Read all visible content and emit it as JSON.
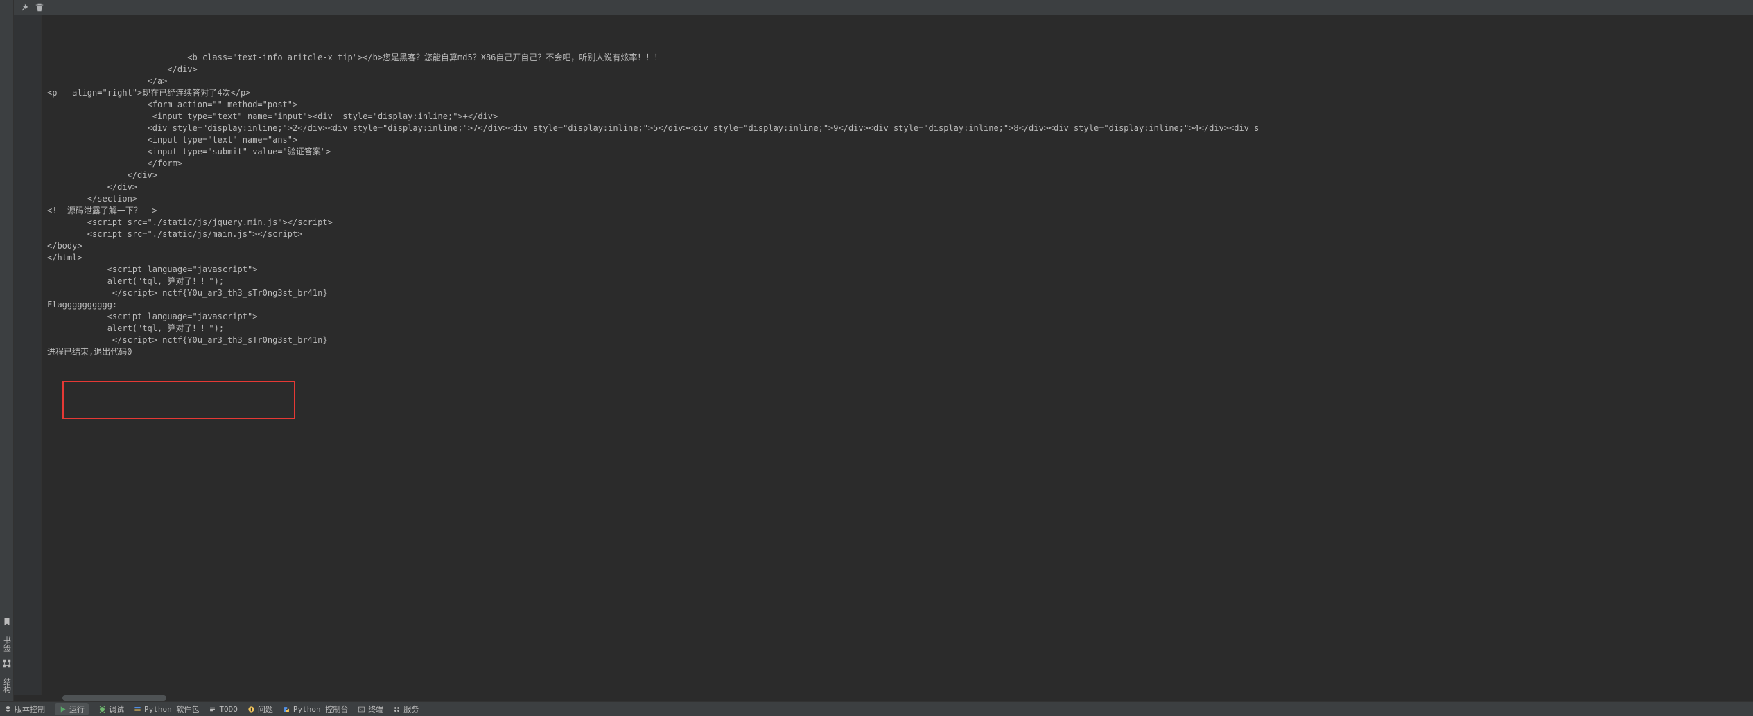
{
  "left_strip": {
    "favorites_label": "书签",
    "structure_label": "结构"
  },
  "panel_header": {
    "pin": "pin",
    "trash": "trash"
  },
  "console": {
    "lines": [
      "                            <b class=\"text-info aritcle-x tip\"></b>您是黑客？您能自算md5？X86自己开自己？不会吧，听别人说有炫率！！！",
      "                        </div>",
      "                    </a>",
      "<p   align=\"right\">现在已经连续答对了4次</p>",
      "",
      "                    <form action=\"\" method=\"post\">",
      "                     <input type=\"text\" name=\"input\"><div  style=\"display:inline;\">+</div>",
      "                    <div style=\"display:inline;\">2</div><div style=\"display:inline;\">7</div><div style=\"display:inline;\">5</div><div style=\"display:inline;\">9</div><div style=\"display:inline;\">8</div><div style=\"display:inline;\">4</div><div s",
      "                    <input type=\"text\" name=\"ans\">",
      "                    <input type=\"submit\" value=\"验证答案\">",
      "                    </form>",
      "                </div>",
      "",
      "            </div>",
      "        </section>",
      "<!--源码泄露了解一下？-->",
      "        <script src=\"./static/js/jquery.min.js\"></script>",
      "        <script src=\"./static/js/main.js\"></script>",
      "</body>",
      "</html>",
      "",
      "",
      "",
      "",
      "",
      "",
      "",
      "            <script language=\"javascript\">",
      "            alert(\"tql, 算对了！！\");",
      "             </script> nctf{Y0u_ar3_th3_sTr0ng3st_br41n}",
      "Flagggggggggg:",
      "            <script language=\"javascript\">",
      "            alert(\"tql, 算对了！！\");",
      "             </script> nctf{Y0u_ar3_th3_sTr0ng3st_br41n}",
      "",
      "进程已结束,退出代码0"
    ],
    "highlight_box": {
      "top_line": 31,
      "bottom_line": 33
    }
  },
  "bottom_bar": {
    "tabs": [
      {
        "label": "版本控制",
        "active": false
      },
      {
        "label": "运行",
        "active": true
      },
      {
        "label": "调试",
        "active": false
      },
      {
        "label": "Python 软件包",
        "active": false
      },
      {
        "label": "TODO",
        "active": false
      },
      {
        "label": "问题",
        "active": false
      },
      {
        "label": "Python 控制台",
        "active": false
      },
      {
        "label": "终端",
        "active": false
      },
      {
        "label": "服务",
        "active": false
      }
    ]
  }
}
